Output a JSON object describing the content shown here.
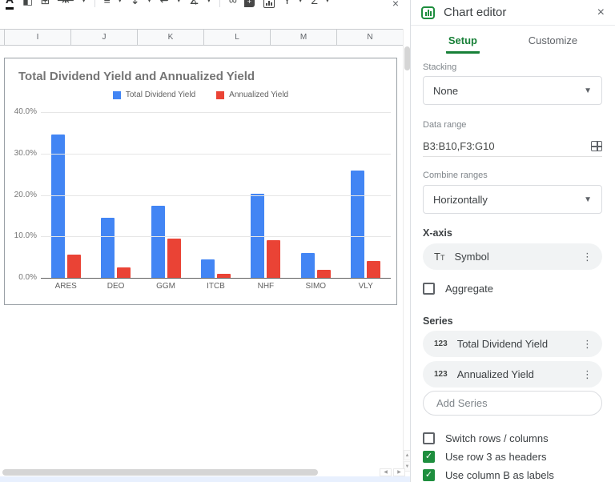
{
  "toolbar": {
    "icons": [
      "text-color",
      "fill-color",
      "borders",
      "merge-cells",
      "divider",
      "horizontal-align",
      "vertical-align",
      "text-wrap",
      "text-rotation",
      "divider",
      "insert-link",
      "insert-comment",
      "insert-chart",
      "create-filter",
      "functions"
    ],
    "close_label": "×"
  },
  "spreadsheet": {
    "column_headers": [
      "I",
      "J",
      "K",
      "L",
      "M",
      "N"
    ]
  },
  "chart_data": {
    "type": "bar",
    "title": "Total Dividend Yield and Annualized Yield",
    "categories": [
      "ARES",
      "DEO",
      "GGM",
      "ITCB",
      "NHF",
      "SIMO",
      "VLY"
    ],
    "series": [
      {
        "name": "Total Dividend Yield",
        "color": "#4285f4",
        "values": [
          34.5,
          14.5,
          17.3,
          4.5,
          20.2,
          6.0,
          25.8
        ]
      },
      {
        "name": "Annualized Yield",
        "color": "#ea4335",
        "values": [
          5.7,
          2.6,
          9.5,
          1.0,
          9.0,
          2.0,
          4.0
        ]
      }
    ],
    "xlabel": "",
    "ylabel": "",
    "y_ticks": [
      "40.0%",
      "30.0%",
      "20.0%",
      "10.0%",
      "0.0%"
    ],
    "ylim": [
      0,
      40
    ],
    "grid": true,
    "legend_position": "top"
  },
  "panel": {
    "title": "Chart editor",
    "close_label": "×",
    "tabs": [
      {
        "label": "Setup",
        "active": true
      },
      {
        "label": "Customize",
        "active": false
      }
    ],
    "stacking": {
      "label": "Stacking",
      "value": "None"
    },
    "data_range": {
      "label": "Data range",
      "value": "B3:B10,F3:G10"
    },
    "combine_ranges": {
      "label": "Combine ranges",
      "value": "Horizontally"
    },
    "x_axis": {
      "heading": "X-axis",
      "icon": "Tt",
      "value": "Symbol"
    },
    "aggregate": {
      "label": "Aggregate",
      "checked": false
    },
    "series_section": {
      "heading": "Series",
      "icon": "123",
      "items": [
        "Total Dividend Yield",
        "Annualized Yield"
      ],
      "add_label": "Add Series"
    },
    "checkboxes": [
      {
        "label": "Switch rows / columns",
        "checked": false
      },
      {
        "label": "Use row 3 as headers",
        "checked": true
      },
      {
        "label": "Use column B as labels",
        "checked": true
      }
    ],
    "colors": {
      "accent_green": "#188038",
      "checkbox_green": "#1e8e3e"
    }
  }
}
